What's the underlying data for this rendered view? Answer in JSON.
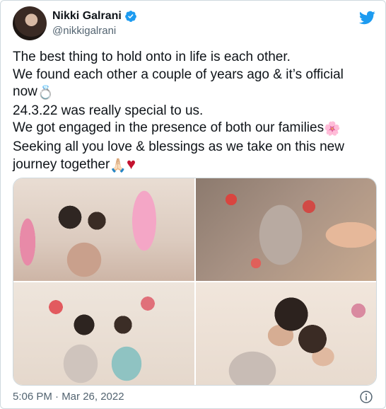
{
  "author": {
    "display_name": "Nikki Galrani",
    "handle": "@nikkigalrani",
    "verified": true
  },
  "tweet": {
    "lines": [
      "The best thing to hold onto in life is each other.",
      "We found each other a couple of years ago & it’s official",
      "now",
      "24.3.22 was really special to us.",
      "We got engaged in the presence of both our families",
      "Seeking all you love & blessings as we take on this new",
      "journey together"
    ],
    "emojis": {
      "ring": "💍",
      "flower": "🌸",
      "folded_hands": "🙏🏻",
      "heart": "♥"
    }
  },
  "media": {
    "photo_count": 4
  },
  "footer": {
    "timestamp": "5:06 PM · Mar 26, 2022"
  },
  "colors": {
    "twitter_blue": "#1d9bf0",
    "text": "#0f1419",
    "secondary_text": "#536471",
    "border": "#cfd9de",
    "heart": "#c4122f"
  },
  "icons": [
    "verified-badge-icon",
    "twitter-bird-icon",
    "info-icon"
  ]
}
